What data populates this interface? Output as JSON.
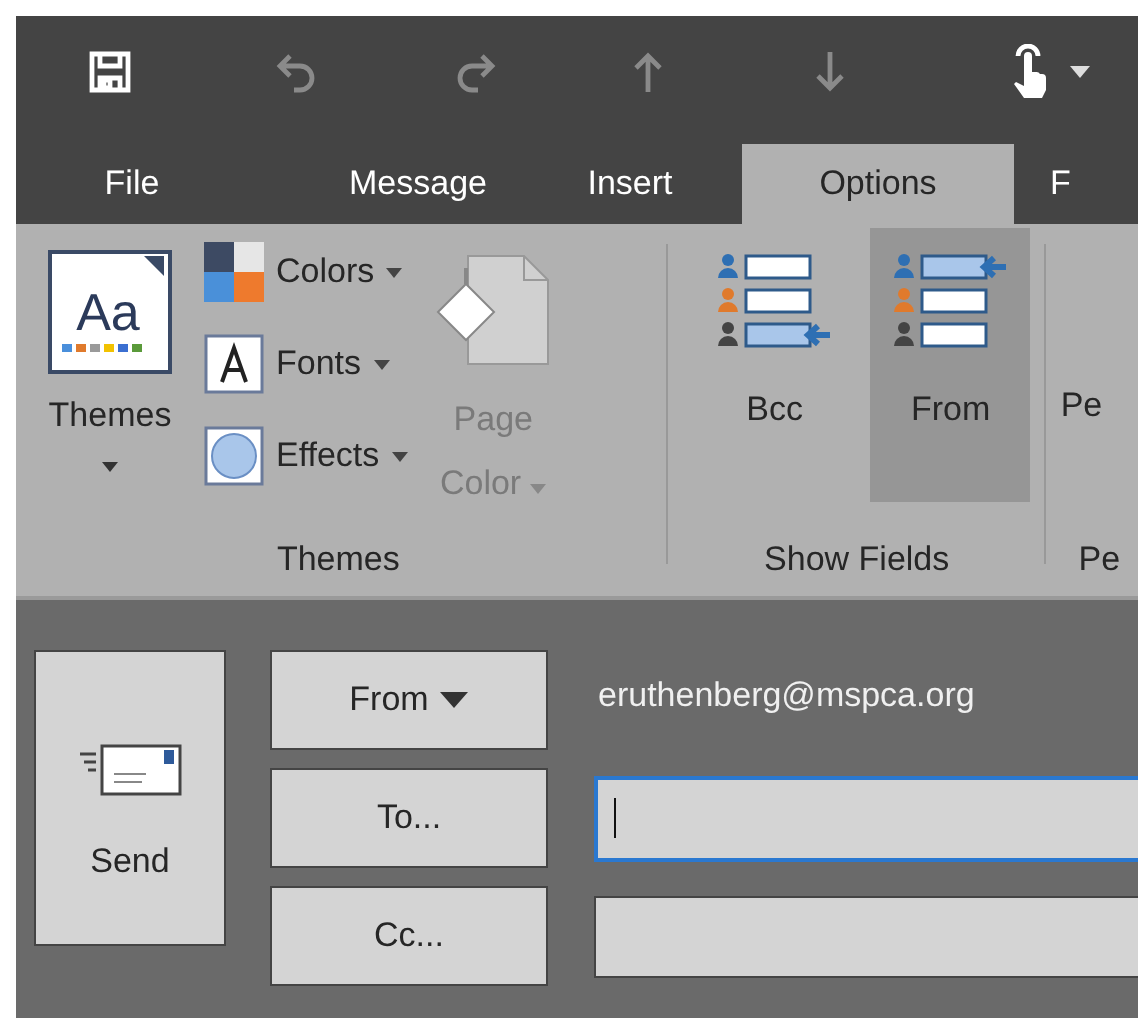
{
  "tabs": [
    {
      "label": "File",
      "selected": false
    },
    {
      "label": "Message",
      "selected": false
    },
    {
      "label": "Insert",
      "selected": false
    },
    {
      "label": "Options",
      "selected": true
    },
    {
      "label": "F",
      "selected": false
    }
  ],
  "ribbon": {
    "themes_group": {
      "label": "Themes",
      "themes_button": {
        "label": "Themes",
        "icon_text": "Aa"
      },
      "small_buttons": [
        {
          "label": "Colors"
        },
        {
          "label": "Fonts"
        },
        {
          "label": "Effects"
        }
      ],
      "page_color": {
        "label_1": "Page",
        "label_2": "Color",
        "disabled": true
      }
    },
    "show_fields_group": {
      "label": "Show Fields",
      "buttons": [
        {
          "label": "Bcc",
          "selected": false
        },
        {
          "label": "From",
          "selected": true
        }
      ]
    },
    "cut_group": {
      "button_label": "Pe",
      "label": "Pe"
    }
  },
  "compose": {
    "send_button": "Send",
    "from_button": "From",
    "from_address": "eruthenberg@mspca.org",
    "to_button": "To...",
    "cc_button": "Cc..."
  }
}
